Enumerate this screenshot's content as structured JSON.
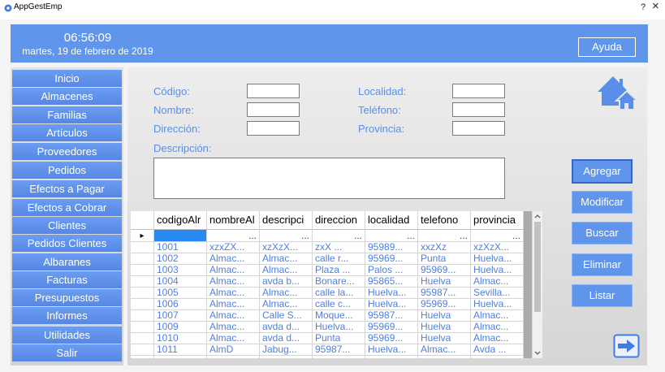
{
  "window": {
    "title": "AppGestEmp",
    "help_glyph": "?",
    "close_glyph": "×"
  },
  "header": {
    "time": "06:56:09",
    "date": "martes, 19 de febrero de 2019",
    "help_button": "Ayuda"
  },
  "sidebar": {
    "items": [
      {
        "label": "Inicio"
      },
      {
        "label": "Almacenes"
      },
      {
        "label": "Familias"
      },
      {
        "label": "Artículos"
      },
      {
        "label": "Proveedores"
      },
      {
        "label": "Pedidos"
      },
      {
        "label": "Efectos a Pagar"
      },
      {
        "label": "Efectos a Cobrar"
      },
      {
        "label": "Clientes"
      },
      {
        "label": "Pedidos Clientes"
      },
      {
        "label": "Albaranes"
      },
      {
        "label": "Facturas"
      },
      {
        "label": "Presupuestos"
      },
      {
        "label": "Informes"
      },
      {
        "label": "Utilidades"
      },
      {
        "label": "Salir"
      }
    ]
  },
  "form": {
    "fields": [
      {
        "label": "Código:",
        "value": ""
      },
      {
        "label": "Nombre:",
        "value": ""
      },
      {
        "label": "Dirección:",
        "value": ""
      },
      {
        "label": "Localidad:",
        "value": ""
      },
      {
        "label": "Teléfono:",
        "value": ""
      },
      {
        "label": "Provincia:",
        "value": ""
      }
    ],
    "description": {
      "label": "Descripción:",
      "value": ""
    }
  },
  "actions": {
    "add": "Agregar",
    "edit": "Modificar",
    "search": "Buscar",
    "delete": "Eliminar",
    "list": "Listar"
  },
  "grid": {
    "columns": [
      "codigoAlr",
      "nombreAl",
      "descripci",
      "direccion",
      "localidad",
      "telefono",
      "provincia"
    ],
    "current_row_marker": "▸",
    "new_row": [
      "",
      "...",
      "...",
      "...",
      "...",
      "...",
      "..."
    ],
    "rows": [
      [
        "1001",
        "xzxZX...",
        "xzXzX...",
        "zxX ...",
        "95989...",
        "xxzXz",
        "xzXzX..."
      ],
      [
        "1002",
        "Almac...",
        "Almac...",
        "calle r...",
        "95969...",
        "Punta",
        "Huelva..."
      ],
      [
        "1003",
        "Almac...",
        "Almac...",
        "Plaza ...",
        "Palos ...",
        "95969...",
        "Huelva..."
      ],
      [
        "1004",
        "Almac...",
        "avda b...",
        "Bonare...",
        "95865...",
        "Huelva",
        "Almac..."
      ],
      [
        "1005",
        "Almac...",
        "Almac...",
        "calle la...",
        "Huelva...",
        "95987...",
        "Sevilla..."
      ],
      [
        "1006",
        "Almac...",
        "Almac...",
        "calle c...",
        "Huelva...",
        "95969...",
        "Huelva..."
      ],
      [
        "1007",
        "Almac...",
        "Calle S...",
        "Moque...",
        "95987...",
        "Huelva",
        "Almac..."
      ],
      [
        "1009",
        "Almac...",
        "avda d...",
        "Huelva...",
        "95969...",
        "Huelva",
        "Almac..."
      ],
      [
        "1010",
        "Almac...",
        "avda d...",
        "Punta",
        "95969...",
        "Huelva",
        "Almac..."
      ],
      [
        "1011",
        "AlmD",
        "Jabug...",
        "95987...",
        "Huelva...",
        "Almac...",
        "Avda ..."
      ]
    ]
  },
  "icons": {
    "app": "app-icon",
    "home": "home-icon",
    "exit": "exit-icon",
    "scroll_up": "chevron-up-icon",
    "scroll_down": "chevron-down-icon"
  },
  "colors": {
    "accent": "#6095ec",
    "label": "#5b8ee8",
    "grid_text": "#4f7fe0",
    "selection": "#2a88f2"
  }
}
